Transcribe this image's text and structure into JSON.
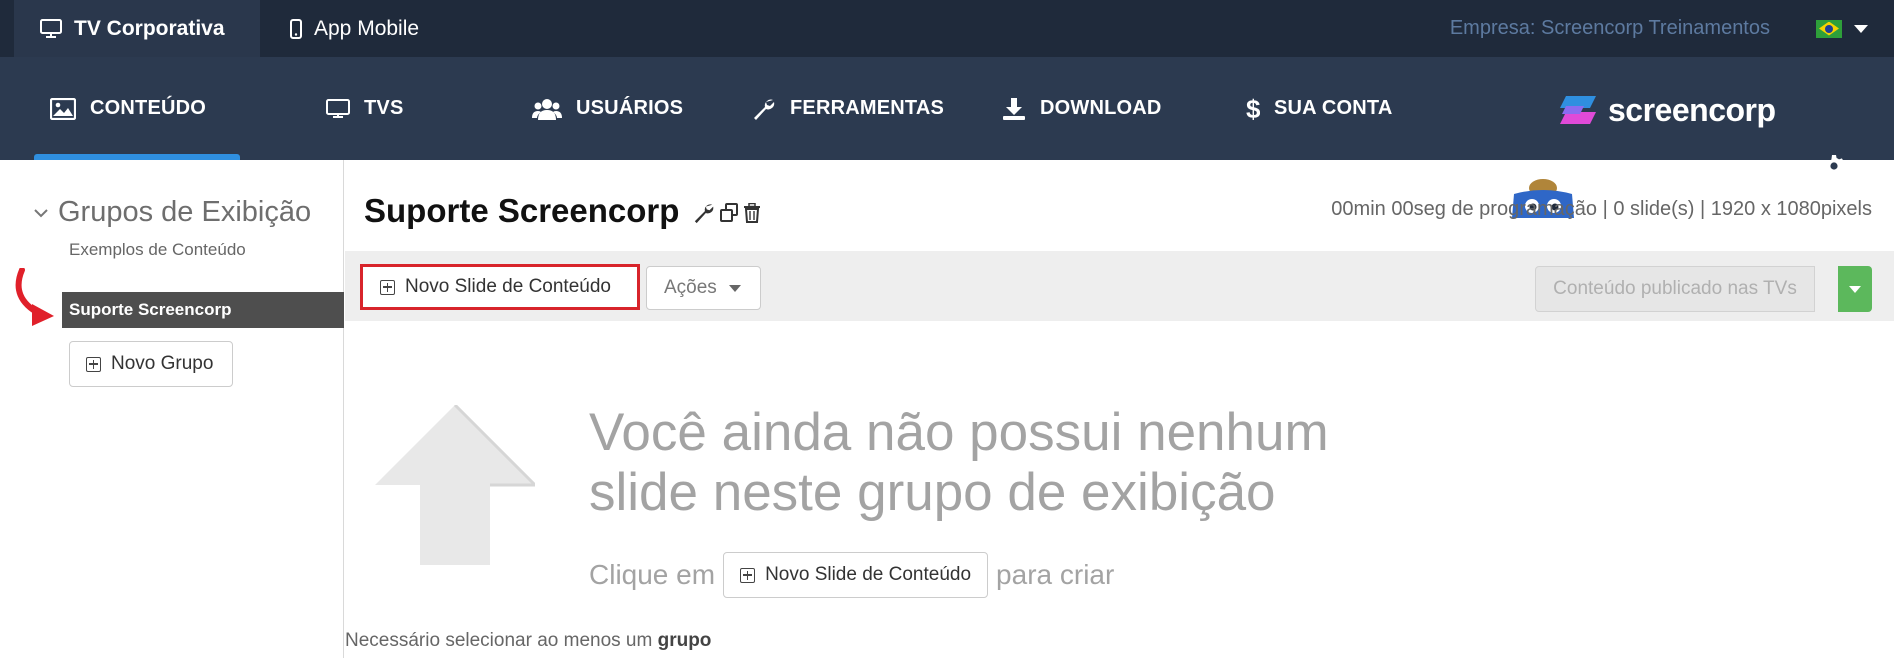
{
  "topbar": {
    "tabs": [
      {
        "label": "TV Corporativa",
        "icon": "monitor-icon"
      },
      {
        "label": "App Mobile",
        "icon": "phone-icon"
      }
    ],
    "company": "Empresa: Screencorp Treinamentos",
    "language_flag": "brazil-flag-icon"
  },
  "nav": {
    "items": [
      {
        "label": "CONTEÚDO",
        "icon": "image-icon"
      },
      {
        "label": "TVS",
        "icon": "monitor-icon"
      },
      {
        "label": "USUÁRIOS",
        "icon": "users-icon"
      },
      {
        "label": "FERRAMENTAS",
        "icon": "wrench-icon"
      },
      {
        "label": "DOWNLOAD",
        "icon": "download-icon"
      },
      {
        "label": "SUA CONTA",
        "icon": "dollar-icon"
      }
    ],
    "logo_text": "screencorp",
    "settings_icon": "gear-icon"
  },
  "sidebar": {
    "title": "Grupos de Exibição",
    "groups": [
      "Exemplos de Conteúdo",
      "Suporte Screencorp"
    ],
    "selected_group": "Suporte Screencorp",
    "new_group_label": "Novo Grupo"
  },
  "content": {
    "title": "Suporte Screencorp",
    "program_info": "00min 00seg de programação | 0 slide(s) | 1920 x 1080pixels",
    "toolbar": {
      "new_slide_label": "Novo Slide de Conteúdo",
      "actions_label": "Ações",
      "published_label": "Conteúdo publicado nas TVs"
    },
    "empty": {
      "line1": "Você ainda não possui nenhum",
      "line2": "slide neste grupo de exibição",
      "cta_prefix": "Clique em",
      "cta_button": "Novo Slide de Conteúdo",
      "cta_suffix": "para criar"
    },
    "footer_note_prefix": "Necessário selecionar ao menos um",
    "footer_note_bold": "grupo"
  },
  "colors": {
    "topbar": "#1f2a3b",
    "nav": "#2c3a50",
    "nav_active_indicator": "#2f8fe0",
    "highlight_red": "#d8242b",
    "publish_green": "#5cb85c"
  }
}
